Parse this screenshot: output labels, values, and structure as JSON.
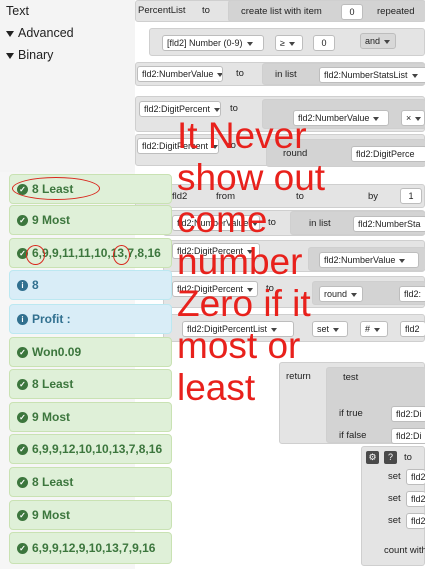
{
  "sidebar": {
    "items": [
      {
        "label": "Text",
        "expanded": false,
        "arrow": false
      },
      {
        "label": "Advanced",
        "arrow": true
      },
      {
        "label": "Binary",
        "arrow": true
      }
    ]
  },
  "workspace": {
    "row1": {
      "var": "PercentList",
      "to": "to",
      "create": "create list with item",
      "count": "0",
      "repeated": "repeated"
    },
    "row2": {
      "field": "[fld2] Number (0-9)",
      "op": "≥",
      "val": "0",
      "and": "and"
    },
    "row3": {
      "var": "fld2:NumberValue",
      "to": "to",
      "inlist": "in list",
      "list": "fld2:NumberStatsList"
    },
    "row4": {
      "var": "fld2:DigitPercent",
      "to": "to",
      "num": "fld2:NumberValue",
      "op": "×"
    },
    "row5": {
      "var": "fld2:DigitPercent",
      "to": "to",
      "round": "round",
      "num": "fld2:DigitPerce"
    },
    "row6": {
      "fld": "fld2",
      "from": "from",
      "to": "to",
      "by": "by",
      "by_val": "1"
    },
    "row7": {
      "var": "fld2:NumberValue",
      "to": "to",
      "inlist": "in list",
      "list": "fld2:NumberSta"
    },
    "row8": {
      "var": "fld2:DigitPercent",
      "to": "to",
      "num": "fld2:NumberValue"
    },
    "row9": {
      "var": "fld2:DigitPercent",
      "to": "to",
      "round": "round",
      "num": "fld2:"
    },
    "row10": {
      "var": "fld2:DigitPercentList",
      "set": "set",
      "hash": "#",
      "num": "fld2"
    },
    "ret": {
      "return": "return",
      "test": "test",
      "iftrue": "if true",
      "iffalse": "if false",
      "a": "fld2:Di",
      "b": "fld2:Di"
    },
    "bottom": {
      "to": "to",
      "set": "set",
      "fld": "fld2",
      "count": "count with"
    }
  },
  "log": [
    {
      "type": "success",
      "text": "8 Least"
    },
    {
      "type": "success",
      "text": "9 Most"
    },
    {
      "type": "success",
      "text": "6,9,9,11,11,10,13,7,8,16"
    },
    {
      "type": "info",
      "text": "8"
    },
    {
      "type": "info",
      "text": "Profit :"
    },
    {
      "type": "success",
      "text": "Won0.09"
    },
    {
      "type": "success",
      "text": "8 Least"
    },
    {
      "type": "success",
      "text": "9 Most"
    },
    {
      "type": "success",
      "text": "6,9,9,12,10,10,13,7,8,16"
    },
    {
      "type": "success",
      "text": "8 Least"
    },
    {
      "type": "success",
      "text": "9 Most"
    },
    {
      "type": "success",
      "text": "6,9,9,12,9,10,13,7,9,16"
    }
  ],
  "annotation": {
    "lines": [
      "It Never",
      "show out",
      "come",
      "number",
      "Zero if it",
      "most or",
      "least"
    ],
    "color": "#e8211c"
  },
  "colors": {
    "success_bg": "#dff0d8",
    "success_text": "#3c763d",
    "info_bg": "#d9edf7",
    "info_text": "#31708f"
  }
}
